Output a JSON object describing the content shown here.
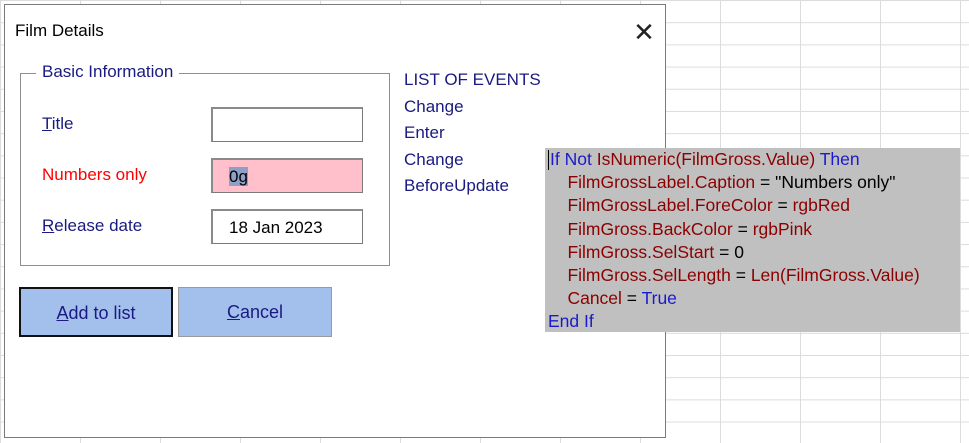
{
  "dialog": {
    "title": "Film Details",
    "close_label": "✕"
  },
  "frame": {
    "label": "Basic Information",
    "title_label_first": "T",
    "title_label_rest": "itle",
    "title_value": "",
    "gross_label": "Numbers only",
    "gross_value": "0g",
    "release_label_first": "R",
    "release_label_rest": "elease date",
    "release_value": "18 Jan 2023"
  },
  "buttons": {
    "add_first": "A",
    "add_rest": "dd to list",
    "cancel_first": "C",
    "cancel_rest": "ancel"
  },
  "events": {
    "heading": "LIST OF EVENTS",
    "items": [
      "Change",
      "Enter",
      "Change",
      "BeforeUpdate"
    ]
  },
  "code": {
    "l1_kw1": "If Not",
    "l1_id": "IsNumeric(FilmGross.Value)",
    "l1_kw2": "Then",
    "l2_id": "FilmGrossLabel.Caption",
    "l2_tx": " = \"Numbers only\"",
    "l3_id": "FilmGrossLabel.ForeColor",
    "l3_tx": " = ",
    "l3_val": "rgbRed",
    "l4_id": "FilmGross.BackColor",
    "l4_tx": " = ",
    "l4_val": "rgbPink",
    "l5_id": "FilmGross.SelStart",
    "l5_tx": " = 0",
    "l6_id": "FilmGross.SelLength",
    "l6_tx": " = ",
    "l6_val": "Len(FilmGross.Value)",
    "l7_id": "Cancel",
    "l7_tx": " = ",
    "l7_kw": "True",
    "l8_kw": "End If"
  },
  "colors": {
    "label_blue": "#1a1a80",
    "error_red": "#ff0000",
    "pink": "#ffc0cb",
    "button_blue": "#a3bfec",
    "code_bg": "#c0c0c0"
  }
}
